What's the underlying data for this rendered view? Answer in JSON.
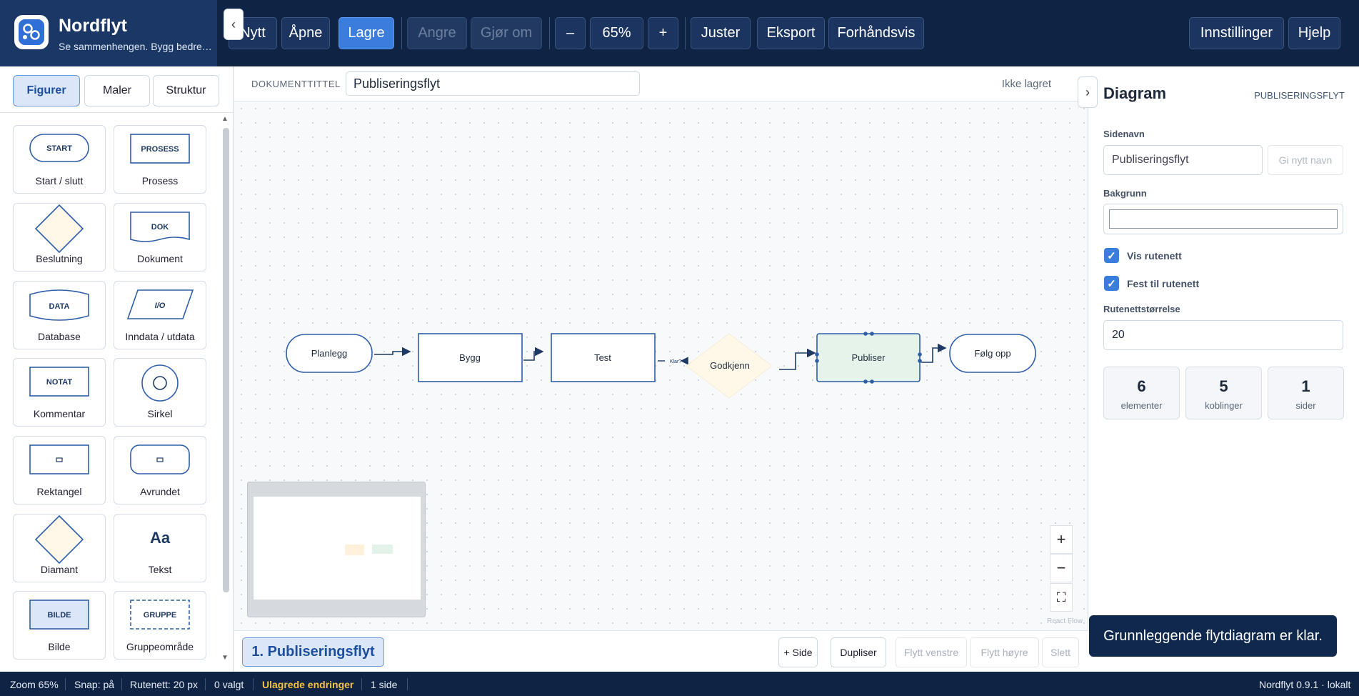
{
  "app": {
    "name": "Nordflyt",
    "tagline": "Se sammenhengen. Bygg bedre…"
  },
  "toolbar": {
    "new": "Nytt",
    "open": "Åpne",
    "save": "Lagre",
    "undo": "Angre",
    "redo": "Gjør om",
    "zoom_out": "–",
    "zoom": "65%",
    "zoom_in": "+",
    "align": "Juster",
    "export": "Eksport",
    "preview": "Forhåndsvis",
    "settings": "Innstillinger",
    "help": "Hjelp"
  },
  "left_panel": {
    "tabs": [
      "Figurer",
      "Maler",
      "Struktur"
    ],
    "collapse": "‹",
    "shapes": [
      {
        "label": "Start / slutt",
        "glyph": "START"
      },
      {
        "label": "Prosess",
        "glyph": "PROSESS"
      },
      {
        "label": "Beslutning",
        "glyph": ""
      },
      {
        "label": "Dokument",
        "glyph": "DOK"
      },
      {
        "label": "Database",
        "glyph": "DATA"
      },
      {
        "label": "Inndata / utdata",
        "glyph": "I/O"
      },
      {
        "label": "Kommentar",
        "glyph": "NOTAT"
      },
      {
        "label": "Sirkel",
        "glyph": ""
      },
      {
        "label": "Rektangel",
        "glyph": ""
      },
      {
        "label": "Avrundet",
        "glyph": ""
      },
      {
        "label": "Diamant",
        "glyph": ""
      },
      {
        "label": "Tekst",
        "glyph": "Aa"
      },
      {
        "label": "Bilde",
        "glyph": "BILDE"
      },
      {
        "label": "Gruppeområde",
        "glyph": "GRUPPE"
      }
    ]
  },
  "document": {
    "label": "DOKUMENTTITTEL",
    "title": "Publiseringsflyt",
    "status": "Ikke lagret",
    "collapse_right": "›"
  },
  "canvas": {
    "nodes": [
      {
        "id": "planlegg",
        "label": "Planlegg"
      },
      {
        "id": "bygg",
        "label": "Bygg"
      },
      {
        "id": "test",
        "label": "Test"
      },
      {
        "id": "godkjenn",
        "label": "Godkjenn"
      },
      {
        "id": "publiser",
        "label": "Publiser"
      },
      {
        "id": "folg-opp",
        "label": "Følg opp"
      }
    ],
    "edge_label": "Klar?",
    "attribution": "React Flow",
    "zoom_controls": {
      "in": "+",
      "out": "−",
      "fit": "⛶"
    }
  },
  "pages": {
    "active": "1. Publiseringsflyt",
    "add": "+ Side",
    "duplicate": "Dupliser",
    "move_left": "Flytt venstre",
    "move_right": "Flytt høyre",
    "delete": "Slett"
  },
  "inspector": {
    "title": "Diagram",
    "doc": "PUBLISERINGSFLYT",
    "page_name_label": "Sidenavn",
    "page_name": "Publiseringsflyt",
    "rename": "Gi nytt navn",
    "background_label": "Bakgrunn",
    "show_grid": "Vis rutenett",
    "snap_grid": "Fest til rutenett",
    "grid_size_label": "Rutenettstørrelse",
    "grid_size": "20",
    "stats": [
      {
        "value": "6",
        "label": "elementer"
      },
      {
        "value": "5",
        "label": "koblinger"
      },
      {
        "value": "1",
        "label": "sider"
      }
    ]
  },
  "toast": "Grunnleggende flytdiagram er klar.",
  "status": {
    "zoom": "Zoom 65%",
    "snap": "Snap: på",
    "grid": "Rutenett: 20 px",
    "selected": "0 valgt",
    "unsaved": "Ulagrede endringer",
    "pages": "1 side",
    "version": "Nordflyt 0.9.1 · lokalt"
  },
  "colors": {
    "brand": "#0f2344",
    "accent": "#3b7ddd",
    "warning": "#f4c046",
    "selected_node": "#e5f3ea",
    "decision_fill": "#fff8e8"
  }
}
